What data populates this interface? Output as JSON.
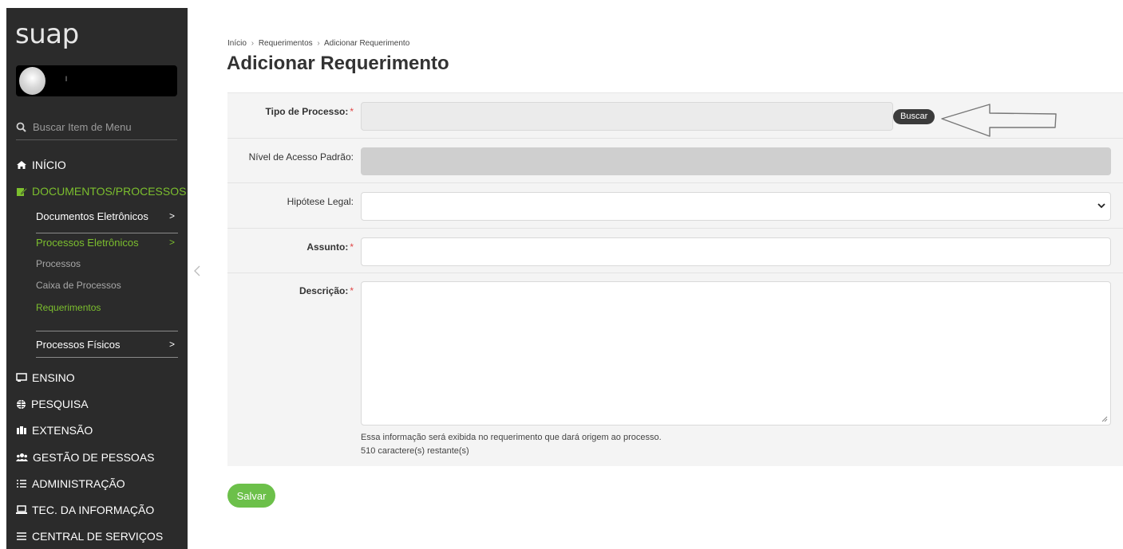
{
  "sidebar": {
    "logo": "suap",
    "user_initial": "l",
    "search_placeholder": "Buscar Item de Menu",
    "menu": {
      "inicio": "INÍCIO",
      "documentos": "DOCUMENTOS/PROCESSOS",
      "documentos_eletronicos": "Documentos Eletrônicos",
      "processos_eletronicos": "Processos Eletrônicos",
      "processos": "Processos",
      "caixa_processos": "Caixa de Processos",
      "requerimentos": "Requerimentos",
      "processos_fisicos": "Processos Físicos",
      "ensino": "ENSINO",
      "pesquisa": "PESQUISA",
      "extensao": "EXTENSÃO",
      "gestao_pessoas": "GESTÃO DE PESSOAS",
      "administracao": "ADMINISTRAÇÃO",
      "tec_informacao": "TEC. DA INFORMAÇÃO",
      "central_servicos": "CENTRAL DE SERVIÇOS"
    },
    "chevron": ">"
  },
  "breadcrumb": [
    "Início",
    "Requerimentos",
    "Adicionar Requerimento"
  ],
  "breadcrumb_sep": "›",
  "page_title": "Adicionar Requerimento",
  "form": {
    "tipo_processo_label": "Tipo de Processo:",
    "nivel_acesso_label": "Nível de Acesso Padrão:",
    "hipotese_legal_label": "Hipótese Legal:",
    "assunto_label": "Assunto:",
    "descricao_label": "Descrição:",
    "required_mark": "*",
    "buscar_button": "Buscar",
    "descricao_help": "Essa informação será exibida no requerimento que dará origem ao processo.",
    "descricao_remaining": "510 caractere(s) restante(s)"
  },
  "salvar_button": "Salvar",
  "colors": {
    "sidebar_bg": "#2b2b2b",
    "accent_green": "#7cbf2e",
    "save_green": "#6cc04a",
    "required_red": "#e04646"
  }
}
